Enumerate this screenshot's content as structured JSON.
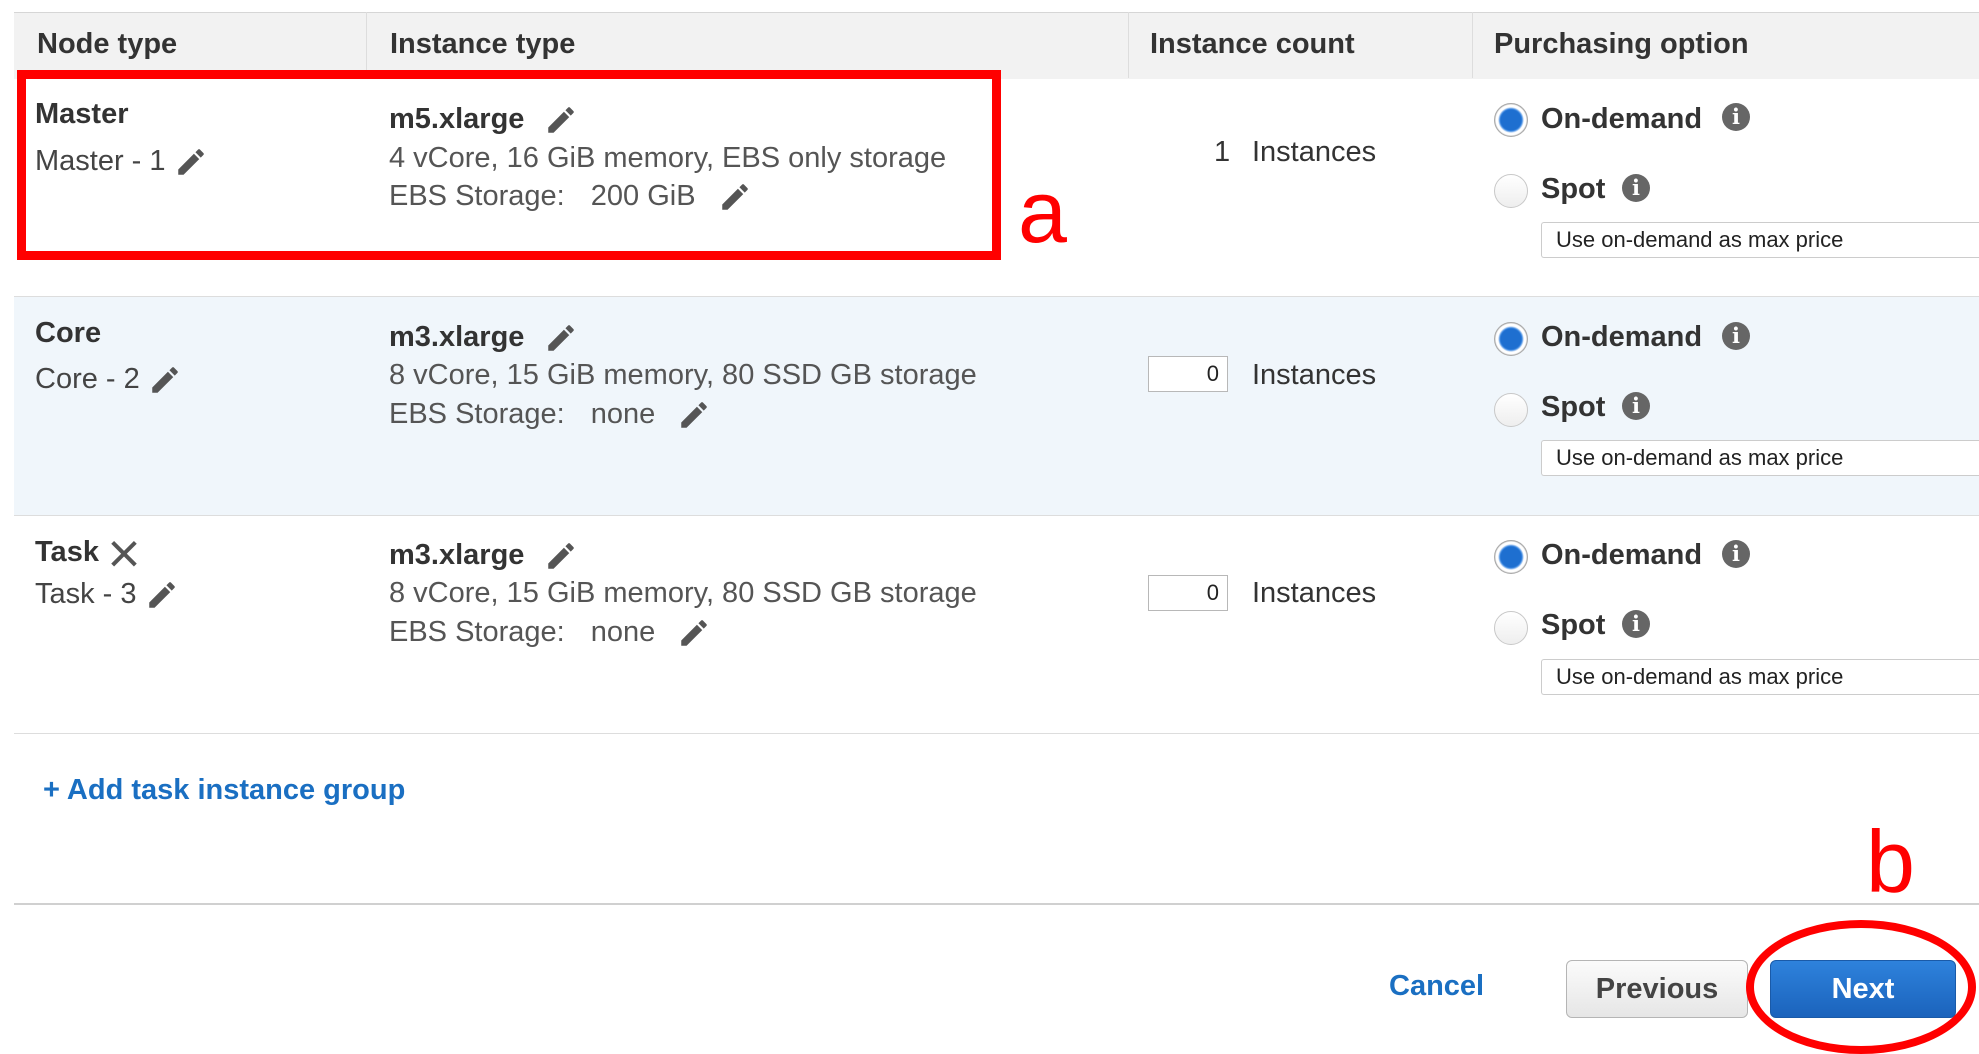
{
  "headers": {
    "node_type": "Node type",
    "instance_type": "Instance type",
    "instance_count": "Instance count",
    "purchasing_option": "Purchasing option"
  },
  "rows": [
    {
      "node": "Master",
      "node_name": "Master - 1",
      "instance_type": "m5.xlarge",
      "specs": "4 vCore, 16 GiB memory, EBS only storage",
      "ebs_label": "EBS Storage:",
      "ebs_value": "200 GiB",
      "count": "1",
      "count_unit": "Instances",
      "on_demand": "On-demand",
      "spot": "Spot",
      "selected_option": "On-demand",
      "price_select": "Use on-demand as max price"
    },
    {
      "node": "Core",
      "node_name": "Core - 2",
      "instance_type": "m3.xlarge",
      "specs": "8 vCore, 15 GiB memory, 80 SSD GB storage",
      "ebs_label": "EBS Storage:",
      "ebs_value": "none",
      "count": "0",
      "count_unit": "Instances",
      "on_demand": "On-demand",
      "spot": "Spot",
      "selected_option": "On-demand",
      "price_select": "Use on-demand as max price"
    },
    {
      "node": "Task",
      "node_name": "Task - 3",
      "instance_type": "m3.xlarge",
      "specs": "8 vCore, 15 GiB memory, 80 SSD GB storage",
      "ebs_label": "EBS Storage:",
      "ebs_value": "none",
      "count": "0",
      "count_unit": "Instances",
      "on_demand": "On-demand",
      "spot": "Spot",
      "selected_option": "On-demand",
      "price_select": "Use on-demand as max price"
    }
  ],
  "add_task_link": "+ Add task instance group",
  "buttons": {
    "cancel": "Cancel",
    "previous": "Previous",
    "next": "Next"
  },
  "annotations": {
    "a": "a",
    "b": "b"
  },
  "icons": {
    "edit": "pencil-icon",
    "remove": "close-icon",
    "info": "info-icon"
  },
  "colors": {
    "link": "#1a6fc2",
    "primary_button": "#1b63bc",
    "annotation": "#ff0000",
    "core_row_bg": "#f0f6fb"
  }
}
